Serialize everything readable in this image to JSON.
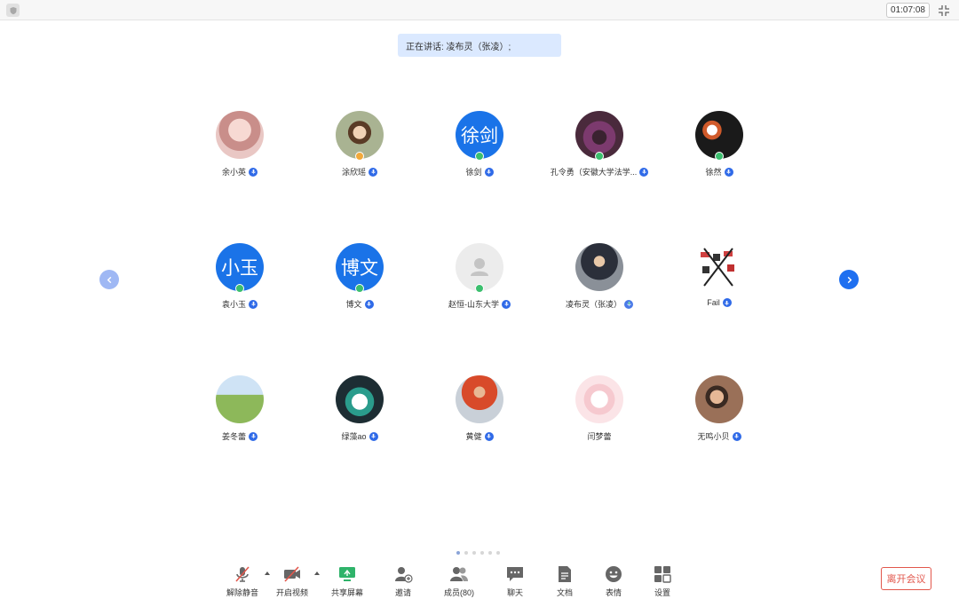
{
  "topbar": {
    "timer": "01:07:08"
  },
  "speaking": {
    "text": "正在讲话: 凌布灵（张凌）;"
  },
  "participants": [
    {
      "name": "余小英"
    },
    {
      "name": "涂欣瑶"
    },
    {
      "name": "徐剑",
      "avatar_text": "徐剑"
    },
    {
      "name": "孔令勇（安徽大学法学..."
    },
    {
      "name": "徐然"
    },
    {
      "name": "袁小玉",
      "avatar_text": "小玉"
    },
    {
      "name": "博文",
      "avatar_text": "博文"
    },
    {
      "name": "赵恒-山东大学"
    },
    {
      "name": "凌布灵（张凌）"
    },
    {
      "name": "Fail"
    },
    {
      "name": "姜冬蕾"
    },
    {
      "name": "绿藻ao"
    },
    {
      "name": "黄健"
    },
    {
      "name": "闫梦蕾"
    },
    {
      "name": "无鸣小贝"
    }
  ],
  "toolbar": {
    "unmute": "解除静音",
    "start_video": "开启视频",
    "share_screen": "共享屏幕",
    "invite": "邀请",
    "members": "成员(80)",
    "chat": "聊天",
    "docs": "文档",
    "emoji": "表情",
    "settings": "设置",
    "leave": "离开会议"
  },
  "colors": {
    "accent": "#1e6ff0",
    "leave": "#e2574c",
    "share_green": "#2fb36a",
    "mute_red": "#e2574c"
  }
}
